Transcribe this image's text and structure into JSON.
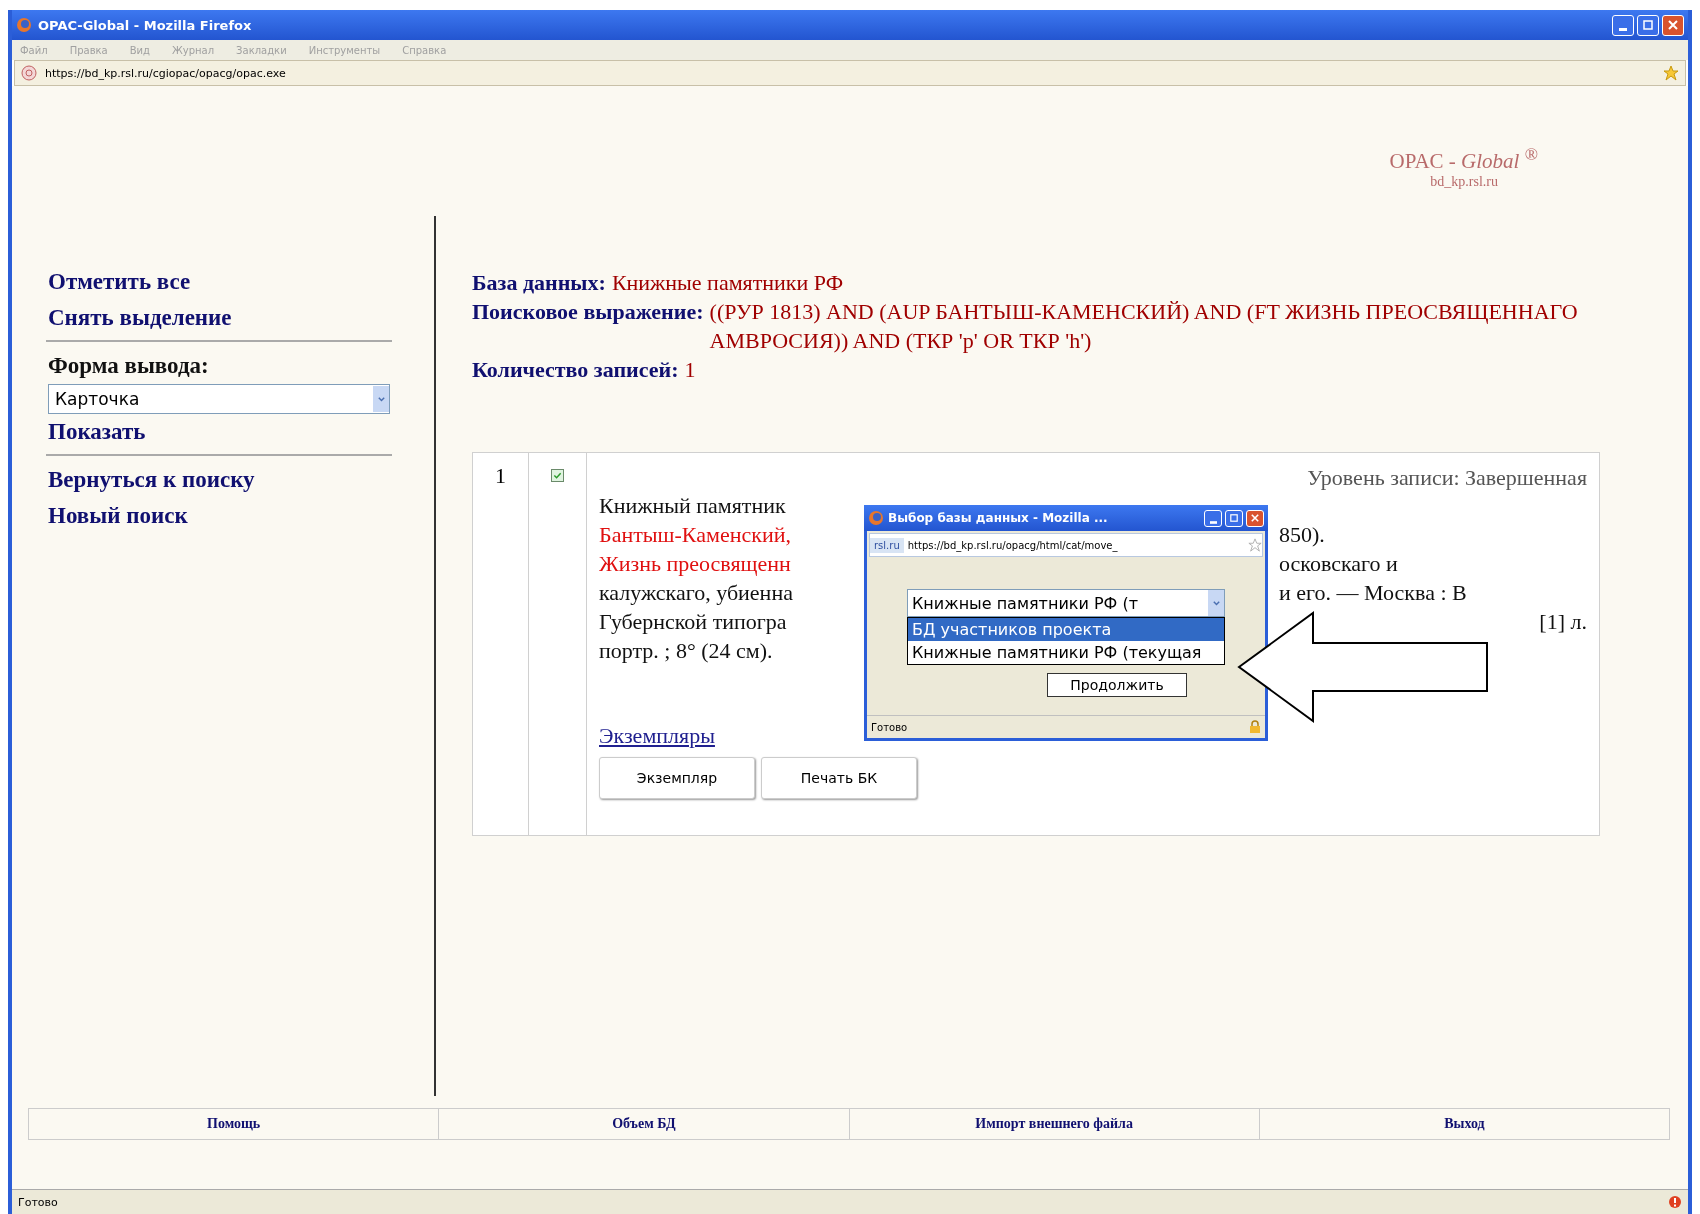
{
  "window": {
    "title": "OPAC-Global - Mozilla Firefox",
    "menu": [
      "Файл",
      "Правка",
      "Вид",
      "Журнал",
      "Закладки",
      "Инструменты",
      "Справка"
    ],
    "url": "https://bd_kp.rsl.ru/cgiopac/opacg/opac.exe"
  },
  "logo": {
    "title": "OPAC - *Global* $^{®}$",
    "subtitle": "bd_kp.rsl.ru"
  },
  "sidebar": [
    {
      "kind": "link",
      "text": "Отметить все"
    },
    {
      "kind": "link",
      "text": "Снять выделение"
    },
    {
      "kind": "divider"
    },
    {
      "kind": "label",
      "text": "Форма вывода:"
    },
    {
      "kind": "select",
      "text": "Карточка"
    },
    {
      "kind": "link",
      "text": "Показать"
    },
    {
      "kind": "divider"
    },
    {
      "kind": "link",
      "text": "Вернуться к поиску"
    },
    {
      "kind": "link",
      "text": "Новый поиск"
    }
  ],
  "summary": [
    {
      "label": "База данных:",
      "value": "Книжные памятники РФ"
    },
    {
      "label": "Поисковое выражение:",
      "value": "((РУР 1813) AND (AUP БАНТЫШ-КАМЕНСКИЙ) AND (FT ЖИЗНЬ ПРЕОСВЯЩЕННАГО АМВРОСИЯ)) AND (ТКР 'р' OR ТКР 'h')"
    },
    {
      "label": "Количество записей:",
      "value": "1"
    }
  ],
  "record": {
    "number": "1",
    "checked": true,
    "status_text": "Уровень записи: Завершенная",
    "lines": [
      {
        "kind": "whole",
        "start": "Книжный памятник",
        "emphasis": false
      },
      {
        "kind": "split",
        "start": "Бантыш-Каменский,",
        "end": "850).",
        "emphasis": true
      },
      {
        "kind": "split",
        "start": "Жизнь преосвященн",
        "end": "осковскаго и",
        "emphasis": true
      },
      {
        "kind": "split",
        "start": "калужскаго, убиенна",
        "end": "и его. — Москва : В",
        "emphasis": false
      },
      {
        "kind": "split_far",
        "start": "Губернской типогра",
        "end": "[1] л.",
        "emphasis": false
      },
      {
        "kind": "whole",
        "start": "портр. ; 8° (24 см).",
        "emphasis": false
      }
    ],
    "copies_link": "Экземпляры",
    "buttons": [
      "Экземпляр",
      "Печать БК"
    ]
  },
  "popup": {
    "title": "Выбор базы данных - Mozilla ...",
    "site": "rsl.ru",
    "url": "https://bd_kp.rsl.ru/opacg/html/cat/move_",
    "select": "Книжные памятники РФ (т",
    "options": [
      {
        "label": "БД участников проекта",
        "selected": true
      },
      {
        "label": "Книжные памятники РФ (текущая",
        "selected": false
      }
    ],
    "button": "Продолжить",
    "status": "Готово"
  },
  "footer": [
    "Помощь",
    "Объем БД",
    "Импорт внешнего файла",
    "Выход"
  ],
  "status_bar": "Готово"
}
